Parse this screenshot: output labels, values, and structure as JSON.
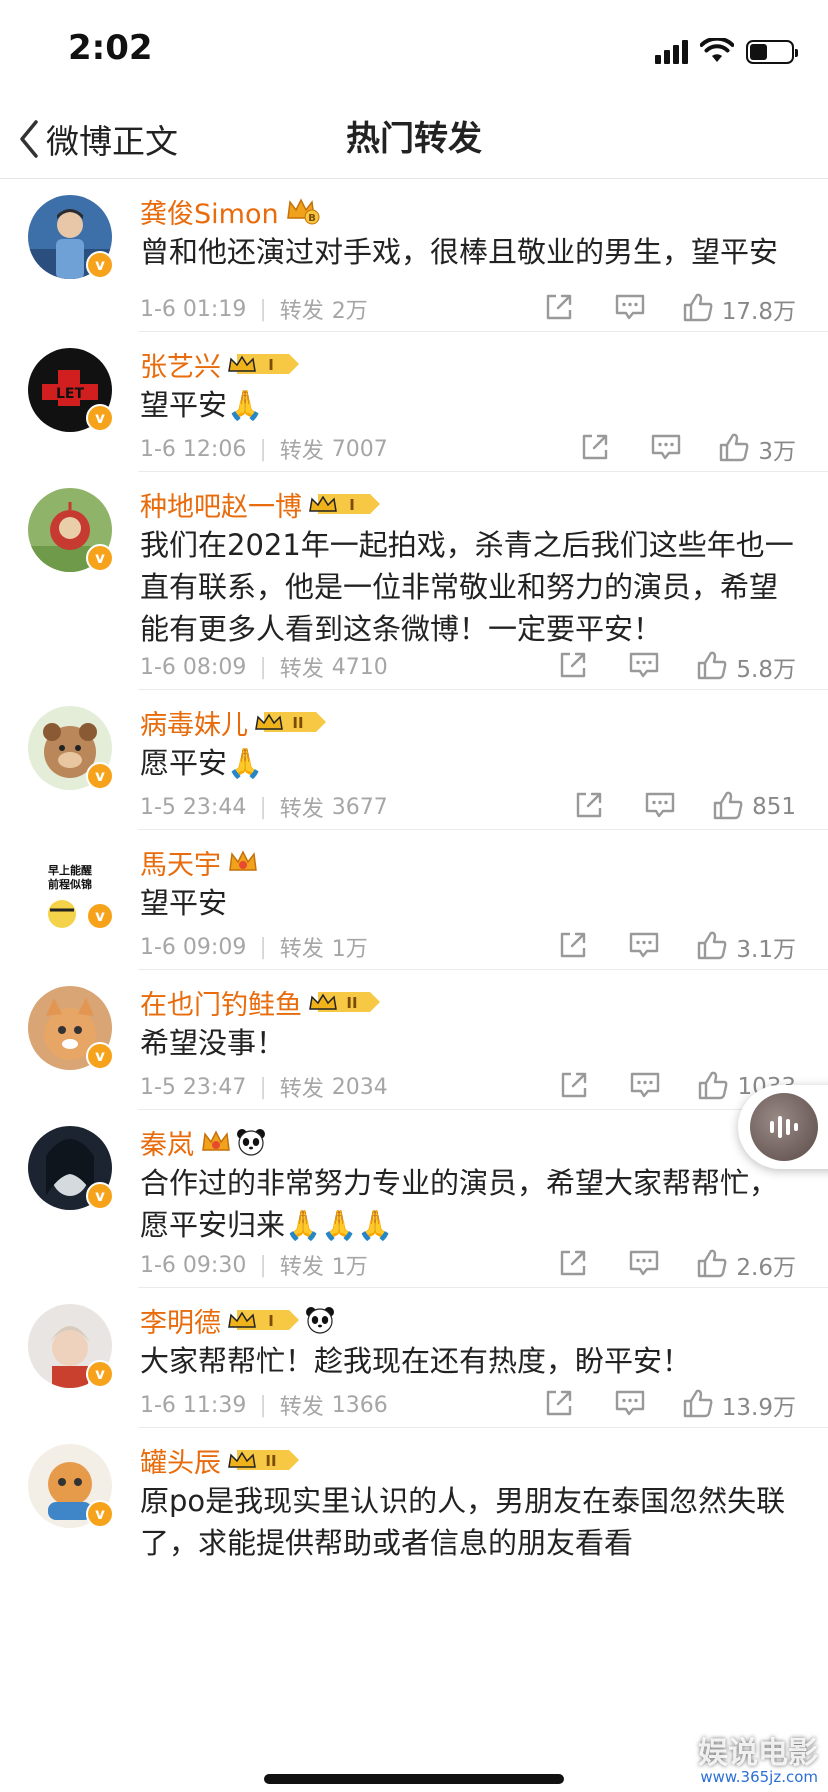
{
  "status_bar": {
    "time": "2:02",
    "battery_percent": 45
  },
  "nav": {
    "back_label": "微博正文",
    "title": "热门转发"
  },
  "repost_label": "转发",
  "posts": [
    {
      "name": "龚俊Simon",
      "badge": "crown-b",
      "content": "曾和他还演过对手戏，很棒且敬业的男生，望平安",
      "time": "1-6 01:19",
      "reposts": "2万",
      "likes": "17.8万"
    },
    {
      "name": "张艺兴",
      "badge": "vip-1",
      "content": "望平安🙏",
      "time": "1-6 12:06",
      "reposts": "7007",
      "likes": "3万"
    },
    {
      "name": "种地吧赵一博",
      "badge": "vip-1",
      "content": "我们在2021年一起拍戏，杀青之后我们这些年也一直有联系，他是一位非常敬业和努力的演员，希望能有更多人看到这条微博！一定要平安！",
      "time": "1-6 08:09",
      "reposts": "4710",
      "likes": "5.8万"
    },
    {
      "name": "病毒妹儿",
      "badge": "vip-2",
      "content": "愿平安🙏",
      "time": "1-5 23:44",
      "reposts": "3677",
      "likes": "851"
    },
    {
      "name": "馬天宇",
      "badge": "crown",
      "content": "望平安",
      "time": "1-6 09:09",
      "reposts": "1万",
      "likes": "3.1万"
    },
    {
      "name": "在也门钓鲑鱼",
      "badge": "vip-2",
      "content": "希望没事！",
      "time": "1-5 23:47",
      "reposts": "2034",
      "likes": "1033"
    },
    {
      "name": "秦岚",
      "badge": "crown-panda",
      "content": "合作过的非常努力专业的演员，希望大家帮帮忙，愿平安归来🙏🙏🙏",
      "time": "1-6 09:30",
      "reposts": "1万",
      "likes": "2.6万"
    },
    {
      "name": "李明德",
      "badge": "vip-1-panda",
      "content": "大家帮帮忙！趁我现在还有热度，盼平安！",
      "time": "1-6 11:39",
      "reposts": "1366",
      "likes": "13.9万"
    },
    {
      "name": "罐头辰",
      "badge": "vip-2",
      "content": "原po是我现实里认识的人，男朋友在泰国忽然失联了，求能提供帮助或者信息的朋友看看",
      "time": "",
      "reposts": "",
      "likes": ""
    }
  ],
  "avatar_text": {
    "post5": "早上能醒 前程似锦"
  },
  "badge_text": {
    "crown_b": "B",
    "vip_1": "I",
    "vip_2": "II"
  },
  "verified_mark": "v",
  "watermark": {
    "text": "娱说电影",
    "url": "www.365jz.com"
  },
  "colors": {
    "name": "#e86b0c",
    "verified": "#f7a21b",
    "meta": "#a6a6a6"
  }
}
